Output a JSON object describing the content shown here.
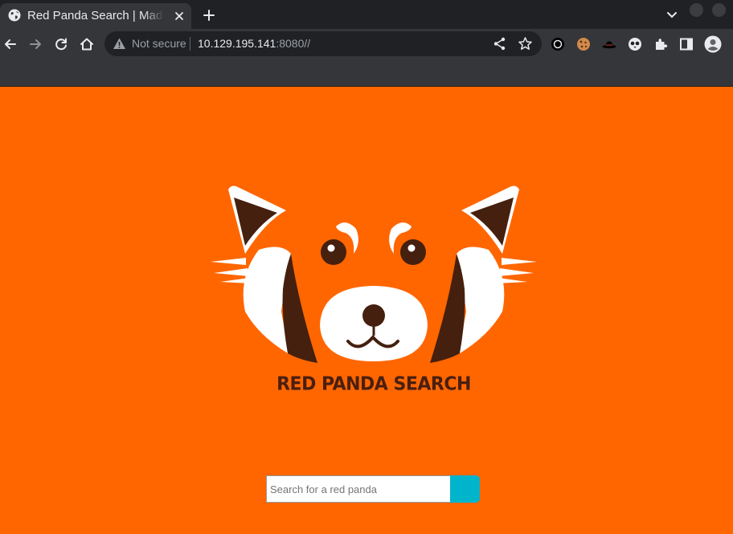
{
  "tab": {
    "title": "Red Panda Search | Made with Spring Boot",
    "favicon": "globe-icon",
    "close": "close-icon"
  },
  "toolbar": {
    "security_label": "Not secure",
    "url_host": "10.129.195.141",
    "url_rest": ":8080//",
    "buttons": [
      "back-icon",
      "forward-icon",
      "reload-icon",
      "home-icon"
    ],
    "extensions": [
      "circle-extension-icon",
      "cookie-icon",
      "hat-icon",
      "owl-icon",
      "puzzle-icon",
      "side-panel-icon",
      "profile-icon"
    ]
  },
  "page": {
    "brand_text": "RED PANDA SEARCH",
    "search_placeholder": "Search for a red panda",
    "search_value": ""
  },
  "colors": {
    "page_background": "#ff6600",
    "panda_dark": "#45200f",
    "search_button": "#00b4cc",
    "chrome_dark": "#202124",
    "chrome_toolbar": "#35363a"
  }
}
